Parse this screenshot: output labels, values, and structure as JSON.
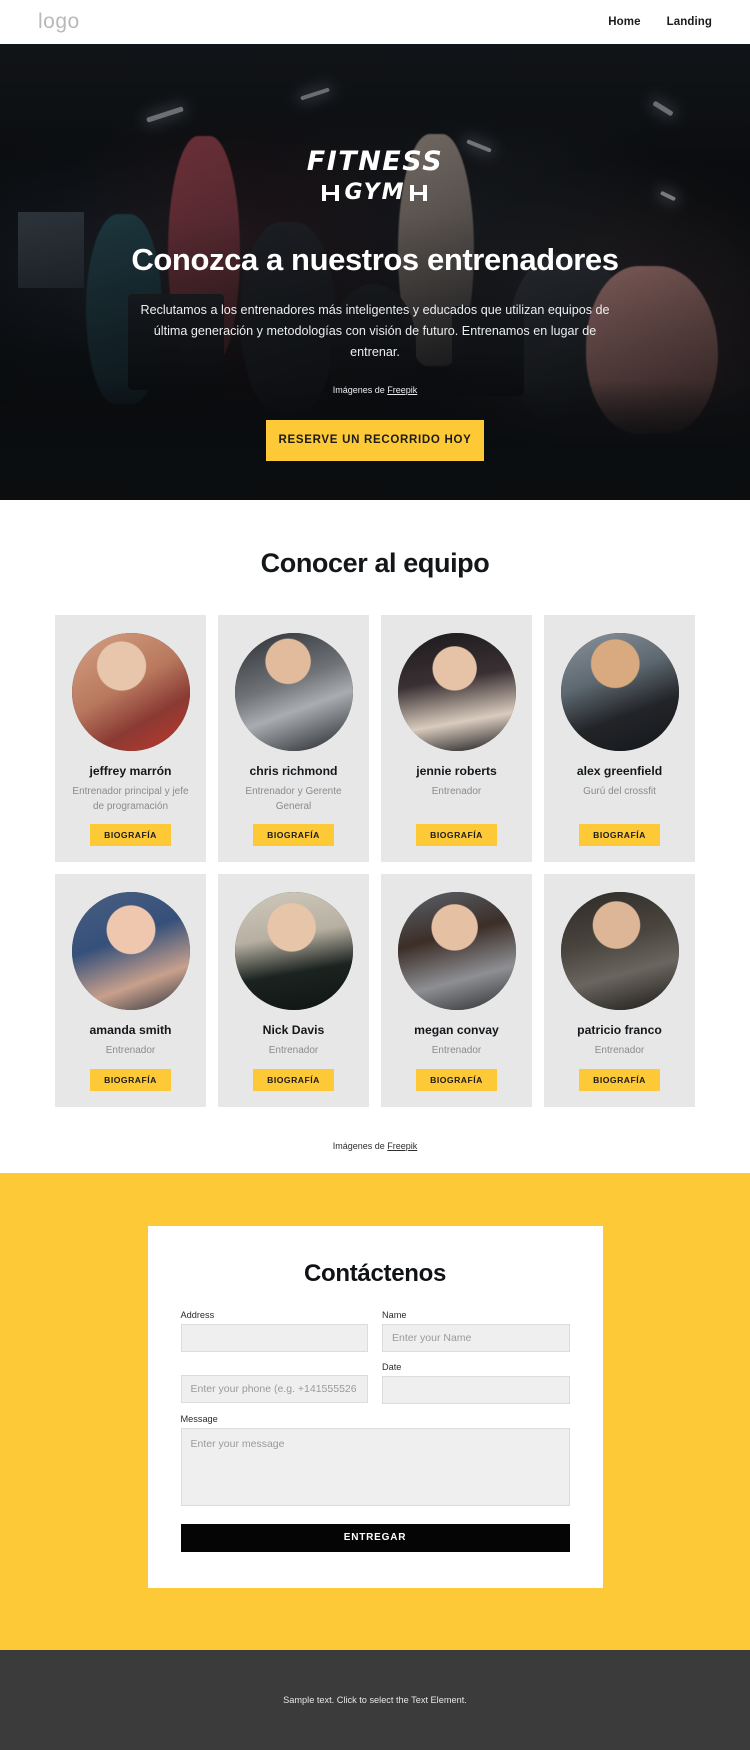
{
  "header": {
    "logo": "logo",
    "nav": [
      {
        "label": "Home"
      },
      {
        "label": "Landing"
      }
    ]
  },
  "hero": {
    "brand_top": "FITNESS",
    "brand_bottom": "GYM",
    "title": "Conozca a nuestros entrenadores",
    "subtitle": "Reclutamos a los entrenadores más inteligentes y educados que utilizan equipos de última generación y metodologías con visión de futuro. Entrenamos en lugar de entrenar.",
    "credit_prefix": "Imágenes de ",
    "credit_link": "Freepik",
    "cta_label": "RESERVE UN RECORRIDO HOY"
  },
  "team": {
    "title": "Conocer al equipo",
    "bio_label": "BIOGRAFÍA",
    "credit_prefix": "Imágenes de ",
    "credit_link": "Freepik",
    "members": [
      {
        "name": "jeffrey marrón",
        "role": "Entrenador principal y jefe de programación",
        "bio": "BIOGRAFÍA"
      },
      {
        "name": "chris richmond",
        "role": "Entrenador y Gerente General",
        "bio": "BIOGRAFÍA"
      },
      {
        "name": "jennie roberts",
        "role": "Entrenador",
        "bio": "BIOGRAFÍA"
      },
      {
        "name": "alex greenfield",
        "role": "Gurú del crossfit",
        "bio": "BIOGRAFÍA"
      },
      {
        "name": "amanda smith",
        "role": "Entrenador",
        "bio": "BIOGRAFÍA"
      },
      {
        "name": "Nick Davis",
        "role": "Entrenador",
        "bio": "BIOGRAFÍA"
      },
      {
        "name": "megan convay",
        "role": "Entrenador",
        "bio": "BIOGRAFÍA"
      },
      {
        "name": "patricio franco",
        "role": "Entrenador",
        "bio": "BIOGRAFÍA"
      }
    ]
  },
  "contact": {
    "title": "Contáctenos",
    "fields": {
      "address_label": "Address",
      "address_value": "",
      "address_placeholder": "",
      "name_label": "Name",
      "name_value": "",
      "name_placeholder": "Enter your Name",
      "phone_label": "",
      "phone_value": "",
      "phone_placeholder": "Enter your phone (e.g. +141555526",
      "date_label": "Date",
      "date_value": "",
      "date_placeholder": "",
      "message_label": "Message",
      "message_value": "",
      "message_placeholder": "Enter your message"
    },
    "submit_label": "ENTREGAR"
  },
  "footer": {
    "text": "Sample text. Click to select the Text Element."
  },
  "colors": {
    "accent": "#fdc937",
    "dark": "#050505",
    "card_bg": "#e7e7e7",
    "footer_bg": "#3b3b3b"
  }
}
